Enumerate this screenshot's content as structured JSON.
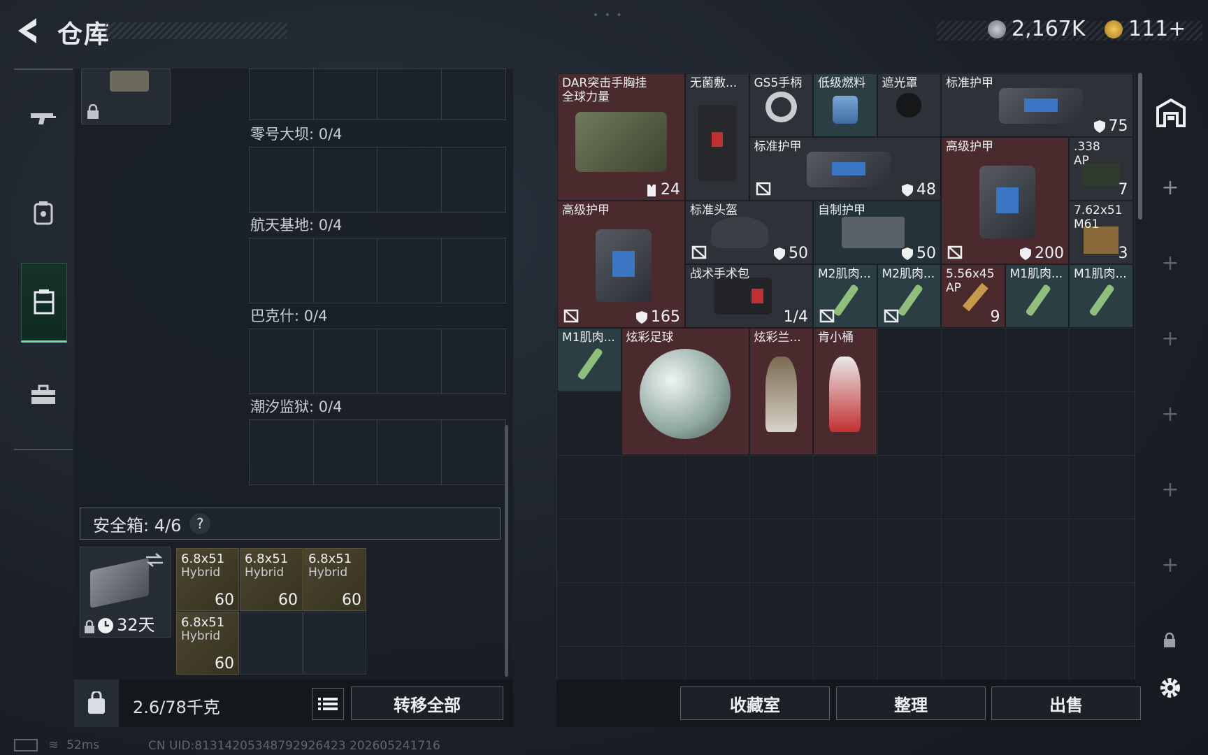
{
  "header": {
    "title": "仓库",
    "currency1": "2,167K",
    "currency2": "111+"
  },
  "left": {
    "locations": [
      {
        "label": "零号大坝: 0/4"
      },
      {
        "label": "航天基地: 0/4"
      },
      {
        "label": "巴克什: 0/4"
      },
      {
        "label": "潮汐监狱: 0/4"
      }
    ],
    "safe_label": "安全箱: 4/6",
    "safe_help": "?",
    "case_timer": "32天",
    "ammo": [
      {
        "name": "6.8x51",
        "sub": "Hybrid",
        "count": "60"
      },
      {
        "name": "6.8x51",
        "sub": "Hybrid",
        "count": "60"
      },
      {
        "name": "6.8x51",
        "sub": "Hybrid",
        "count": "60"
      },
      {
        "name": "6.8x51",
        "sub": "Hybrid",
        "count": "60"
      }
    ],
    "weight": "2.6/78千克",
    "transfer_all": "转移全部"
  },
  "items": [
    {
      "name": "DAR突击手胸挂\n全球力量",
      "count": "24"
    },
    {
      "name": "无菌敷...",
      "count": ""
    },
    {
      "name": "GS5手柄",
      "count": ""
    },
    {
      "name": "低级燃料",
      "count": ""
    },
    {
      "name": "遮光罩",
      "count": ""
    },
    {
      "name": "标准护甲",
      "count": "75"
    },
    {
      "name": "标准护甲",
      "count": "48"
    },
    {
      "name": "高级护甲",
      "count": "200"
    },
    {
      "name": ".338\nAP",
      "count": "7"
    },
    {
      "name": "高级护甲",
      "count": "165"
    },
    {
      "name": "标准头盔",
      "count": "50"
    },
    {
      "name": "自制护甲",
      "count": "50"
    },
    {
      "name": "7.62x51\nM61",
      "count": "3"
    },
    {
      "name": "战术手术包",
      "count": "1/4"
    },
    {
      "name": "M2肌肉...",
      "count": ""
    },
    {
      "name": "M2肌肉...",
      "count": ""
    },
    {
      "name": "5.56x45\nAP",
      "count": "9"
    },
    {
      "name": "M1肌肉...",
      "count": ""
    },
    {
      "name": "M1肌肉...",
      "count": ""
    },
    {
      "name": "M1肌肉...",
      "count": ""
    },
    {
      "name": "炫彩足球",
      "count": ""
    },
    {
      "name": "炫彩兰...",
      "count": ""
    },
    {
      "name": "肯小桶",
      "count": ""
    }
  ],
  "buttons": {
    "collection": "收藏室",
    "sort": "整理",
    "sell": "出售"
  },
  "footer": {
    "ping": "52ms",
    "uid": "CN UID:81314205348792926423 202605241716"
  }
}
